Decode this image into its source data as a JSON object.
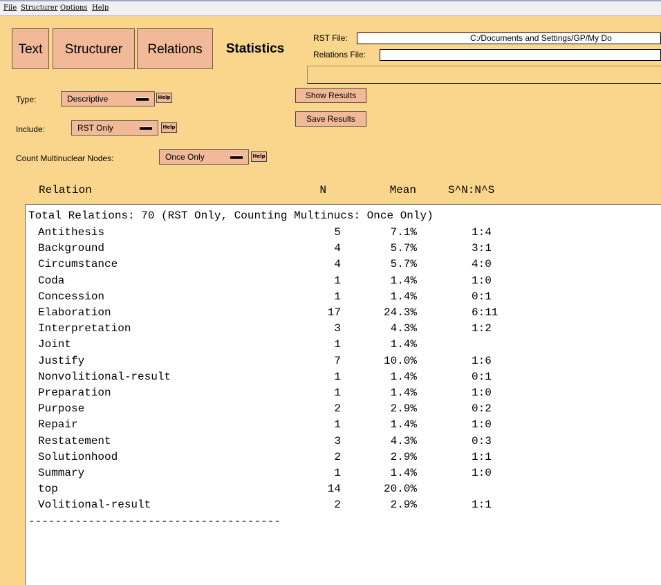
{
  "menu": [
    "File",
    "Structurer",
    "Options",
    "Help"
  ],
  "tabs": [
    "Text",
    "Structurer",
    "Relations"
  ],
  "active_tab": "Statistics",
  "rst_file": {
    "label": "RST File:",
    "value": "C:/Documents and Settings/GP/My Do"
  },
  "relations_file": {
    "label": "Relations File:",
    "value": ""
  },
  "controls": {
    "type_label": "Type:",
    "type_value": "Descriptive",
    "include_label": "Include:",
    "include_value": "RST Only",
    "count_label": "Count Multinuclear Nodes:",
    "count_value": "Once Only",
    "help_label": "Help",
    "show_results": "Show Results",
    "save_results": "Save Results"
  },
  "columns": {
    "relation": "Relation",
    "n": "N",
    "mean": "Mean",
    "ratio": "S^N:N^S"
  },
  "summary": "Total Relations: 70 (RST Only, Counting Multinucs: Once Only)",
  "rows": [
    {
      "name": "Antithesis",
      "n": "5",
      "mean": "7.1%",
      "ratio": "1:4"
    },
    {
      "name": "Background",
      "n": "4",
      "mean": "5.7%",
      "ratio": "3:1"
    },
    {
      "name": "Circumstance",
      "n": "4",
      "mean": "5.7%",
      "ratio": "4:0"
    },
    {
      "name": "Coda",
      "n": "1",
      "mean": "1.4%",
      "ratio": "1:0"
    },
    {
      "name": "Concession",
      "n": "1",
      "mean": "1.4%",
      "ratio": "0:1"
    },
    {
      "name": "Elaboration",
      "n": "17",
      "mean": "24.3%",
      "ratio": "6:11"
    },
    {
      "name": "Interpretation",
      "n": "3",
      "mean": "4.3%",
      "ratio": "1:2"
    },
    {
      "name": "Joint",
      "n": "1",
      "mean": "1.4%",
      "ratio": ""
    },
    {
      "name": "Justify",
      "n": "7",
      "mean": "10.0%",
      "ratio": "1:6"
    },
    {
      "name": "Nonvolitional-result",
      "n": "1",
      "mean": "1.4%",
      "ratio": "0:1"
    },
    {
      "name": "Preparation",
      "n": "1",
      "mean": "1.4%",
      "ratio": "1:0"
    },
    {
      "name": "Purpose",
      "n": "2",
      "mean": "2.9%",
      "ratio": "0:2"
    },
    {
      "name": "Repair",
      "n": "1",
      "mean": "1.4%",
      "ratio": "1:0"
    },
    {
      "name": "Restatement",
      "n": "3",
      "mean": "4.3%",
      "ratio": "0:3"
    },
    {
      "name": "Solutionhood",
      "n": "2",
      "mean": "2.9%",
      "ratio": "1:1"
    },
    {
      "name": "Summary",
      "n": "1",
      "mean": "1.4%",
      "ratio": "1:0"
    },
    {
      "name": "top",
      "n": "14",
      "mean": "20.0%",
      "ratio": ""
    },
    {
      "name": "Volitional-result",
      "n": "2",
      "mean": "2.9%",
      "ratio": "1:1"
    }
  ],
  "separator": "--------------------------------------"
}
